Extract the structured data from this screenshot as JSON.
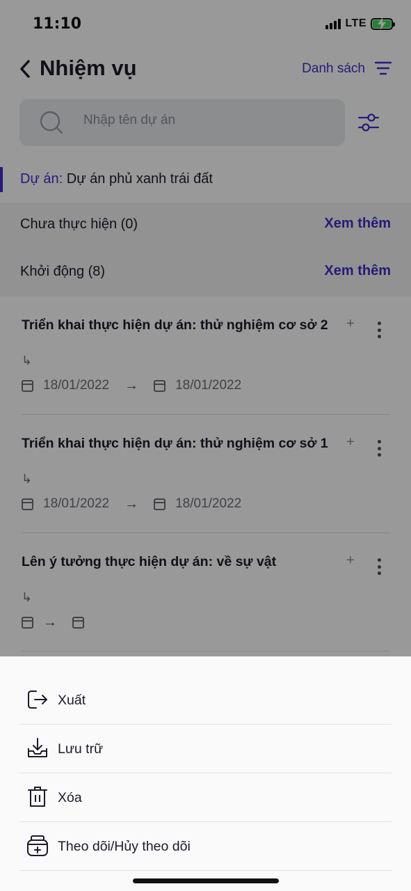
{
  "status_bar": {
    "time": "11:10",
    "network": "LTE",
    "battery_charging": true,
    "icons": [
      "signal-icon",
      "battery-icon"
    ]
  },
  "header": {
    "back_icon": "chevron-left-icon",
    "title": "Nhiệm vụ",
    "view_label": "Danh sách",
    "view_icon": "sort-lines-icon"
  },
  "search": {
    "placeholder": "Nhập tên dự án",
    "value": "",
    "icon": "search-icon",
    "filter_icon": "sliders-icon"
  },
  "project": {
    "prefix": "Dự án:",
    "name": " Dự án phủ xanh trái đất"
  },
  "status_groups": [
    {
      "label": "Chưa thực hiện (0)",
      "more": "Xem thêm"
    },
    {
      "label": "Khởi động (8)",
      "more": "Xem thêm"
    }
  ],
  "tasks": [
    {
      "title": "Triển khai thực hiện dự án: thử nghiệm cơ sở 2",
      "plus": "+",
      "sub_icon": "↳",
      "start_date": "18/01/2022",
      "end_date": "18/01/2022"
    },
    {
      "title": "Triển khai thực hiện dự án: thử nghiệm cơ sở 1",
      "plus": "+",
      "sub_icon": "↳",
      "start_date": "18/01/2022",
      "end_date": "18/01/2022"
    },
    {
      "title": "Lên ý tưởng thực hiện dự án: về sự vật",
      "plus": "+",
      "sub_icon": "↳",
      "start_date": "",
      "end_date": ""
    }
  ],
  "arrow": "→",
  "action_sheet": {
    "items": [
      {
        "label": "Xuất",
        "icon": "export-icon"
      },
      {
        "label": "Lưu trữ",
        "icon": "archive-download-icon"
      },
      {
        "label": "Xóa",
        "icon": "trash-icon"
      },
      {
        "label": "Theo dõi/Hủy theo dõi",
        "icon": "follow-icon"
      }
    ]
  },
  "colors": {
    "accent": "#3f2fc7",
    "overlay": "rgba(0,0,0,0.40)",
    "sheet_background": "#fafafa",
    "status_group_background": "#f3f3f5"
  }
}
